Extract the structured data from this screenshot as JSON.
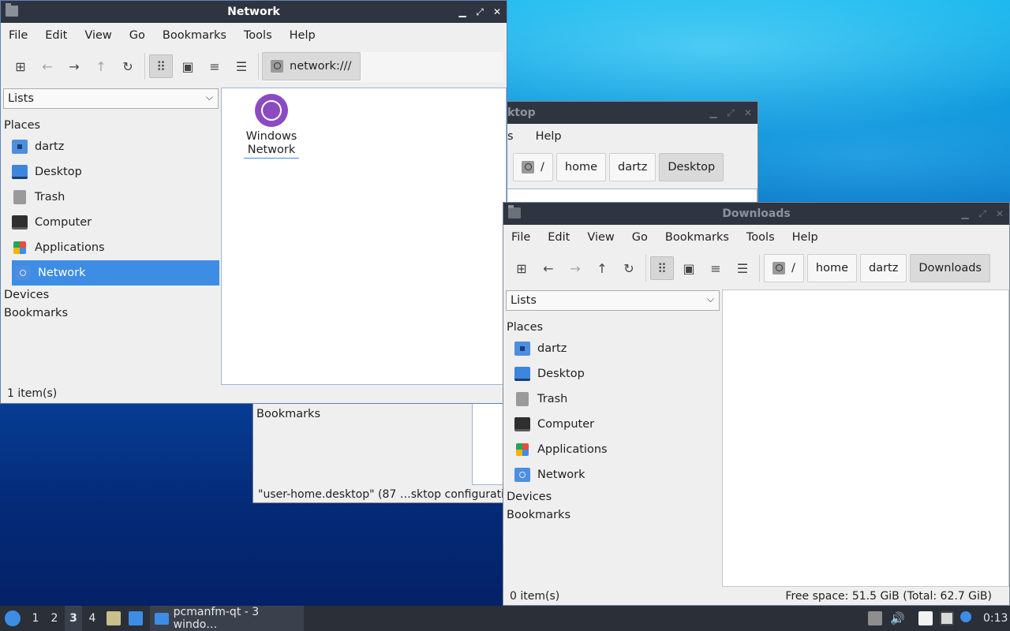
{
  "desktop_window": {
    "title_fragment": "ktop",
    "menu_fragment": "s",
    "menu_help": "Help",
    "crumbs": [
      "/",
      "home",
      "dartz",
      "Desktop"
    ],
    "bookmarks": "Bookmarks",
    "status": "\"user-home.desktop\" (87 …sktop configuratio"
  },
  "network_window": {
    "title": "Network",
    "menu": [
      "File",
      "Edit",
      "View",
      "Go",
      "Bookmarks",
      "Tools",
      "Help"
    ],
    "location": "network:///",
    "lists_label": "Lists",
    "places_label": "Places",
    "places": [
      {
        "label": "dartz",
        "icon": "home-folder-icon"
      },
      {
        "label": "Desktop",
        "icon": "desktop-icon"
      },
      {
        "label": "Trash",
        "icon": "trash-icon"
      },
      {
        "label": "Computer",
        "icon": "computer-icon"
      },
      {
        "label": "Applications",
        "icon": "applications-icon"
      },
      {
        "label": "Network",
        "icon": "network-icon"
      }
    ],
    "devices_label": "Devices",
    "bookmarks_label": "Bookmarks",
    "file_line1": "Windows",
    "file_line2": "Network",
    "status": "1 item(s)"
  },
  "downloads_window": {
    "title": "Downloads",
    "menu": [
      "File",
      "Edit",
      "View",
      "Go",
      "Bookmarks",
      "Tools",
      "Help"
    ],
    "crumbs": [
      "/",
      "home",
      "dartz",
      "Downloads"
    ],
    "lists_label": "Lists",
    "places_label": "Places",
    "places": [
      {
        "label": "dartz",
        "icon": "home-folder-icon"
      },
      {
        "label": "Desktop",
        "icon": "desktop-icon"
      },
      {
        "label": "Trash",
        "icon": "trash-icon"
      },
      {
        "label": "Computer",
        "icon": "computer-icon"
      },
      {
        "label": "Applications",
        "icon": "applications-icon"
      },
      {
        "label": "Network",
        "icon": "network-icon"
      }
    ],
    "devices_label": "Devices",
    "bookmarks_label": "Bookmarks",
    "status_left": "0 item(s)",
    "status_right": "Free space: 51.5 GiB (Total: 62.7 GiB)"
  },
  "taskbar": {
    "workspaces": [
      "1",
      "2",
      "3",
      "4"
    ],
    "current_workspace": "3",
    "task_label": "pcmanfm-qt - 3 windo…",
    "clock": "0:13"
  },
  "colors": {
    "selection": "#3d8de5",
    "titlebar": "#2f3540",
    "taskbar": "#2a2f38"
  }
}
